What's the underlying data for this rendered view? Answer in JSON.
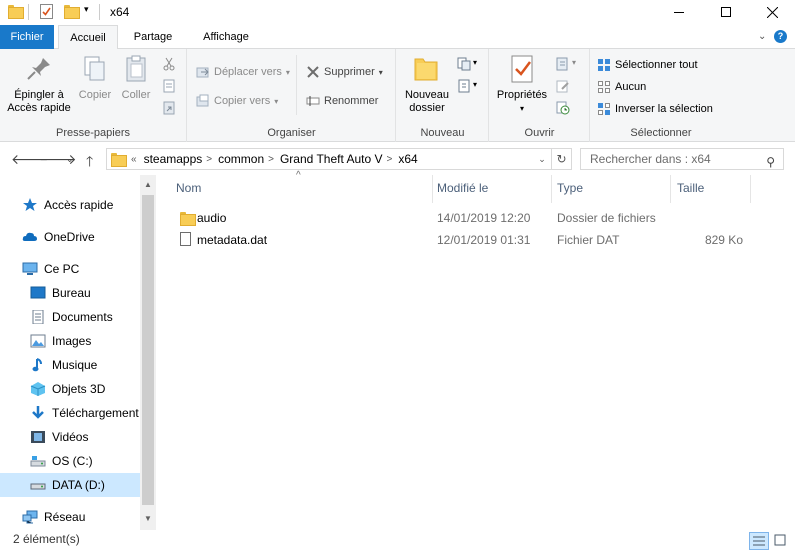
{
  "window": {
    "title": "x64"
  },
  "tabs": {
    "file": "Fichier",
    "home": "Accueil",
    "share": "Partage",
    "view": "Affichage"
  },
  "ribbon": {
    "clipboard": {
      "label": "Presse-papiers",
      "pin_line1": "Épingler à",
      "pin_line2": "Accès rapide",
      "copy": "Copier",
      "paste": "Coller"
    },
    "organize": {
      "label": "Organiser",
      "move_to": "Déplacer vers",
      "copy_to": "Copier vers",
      "delete": "Supprimer",
      "rename": "Renommer"
    },
    "new": {
      "label": "Nouveau",
      "new_folder_line1": "Nouveau",
      "new_folder_line2": "dossier"
    },
    "open": {
      "label": "Ouvrir",
      "properties": "Propriétés"
    },
    "select": {
      "label": "Sélectionner",
      "select_all": "Sélectionner tout",
      "select_none": "Aucun",
      "invert": "Inverser la sélection"
    }
  },
  "address": {
    "overflow": "«",
    "crumbs": [
      "steamapps",
      "common",
      "Grand Theft Auto V",
      "x64"
    ]
  },
  "search": {
    "placeholder": "Rechercher dans : x64"
  },
  "sidebar": {
    "items": [
      {
        "label": "Accès rapide",
        "icon": "star-icon"
      },
      {
        "label": "OneDrive",
        "icon": "cloud-icon"
      },
      {
        "label": "Ce PC",
        "icon": "computer-icon"
      },
      {
        "label": "Bureau",
        "icon": "desktop-icon"
      },
      {
        "label": "Documents",
        "icon": "documents-icon"
      },
      {
        "label": "Images",
        "icon": "pictures-icon"
      },
      {
        "label": "Musique",
        "icon": "music-icon"
      },
      {
        "label": "Objets 3D",
        "icon": "3d-objects-icon"
      },
      {
        "label": "Téléchargement",
        "icon": "download-icon"
      },
      {
        "label": "Vidéos",
        "icon": "videos-icon"
      },
      {
        "label": "OS (C:)",
        "icon": "drive-icon"
      },
      {
        "label": "DATA (D:)",
        "icon": "drive-icon"
      },
      {
        "label": "Réseau",
        "icon": "network-icon"
      }
    ],
    "selected": "DATA (D:)"
  },
  "filelist": {
    "columns": {
      "name": "Nom",
      "modified": "Modifié le",
      "type": "Type",
      "size": "Taille"
    },
    "rows": [
      {
        "name": "audio",
        "modified": "14/01/2019 12:20",
        "type": "Dossier de fichiers",
        "size": "",
        "icon": "folder-icon"
      },
      {
        "name": "metadata.dat",
        "modified": "12/01/2019 01:31",
        "type": "Fichier DAT",
        "size": "829 Ko",
        "icon": "file-icon"
      }
    ]
  },
  "status": {
    "count": "2 élément(s)"
  },
  "colors": {
    "accent": "#1979ca",
    "selection": "#cce8ff",
    "folder": "#f8cd56"
  }
}
